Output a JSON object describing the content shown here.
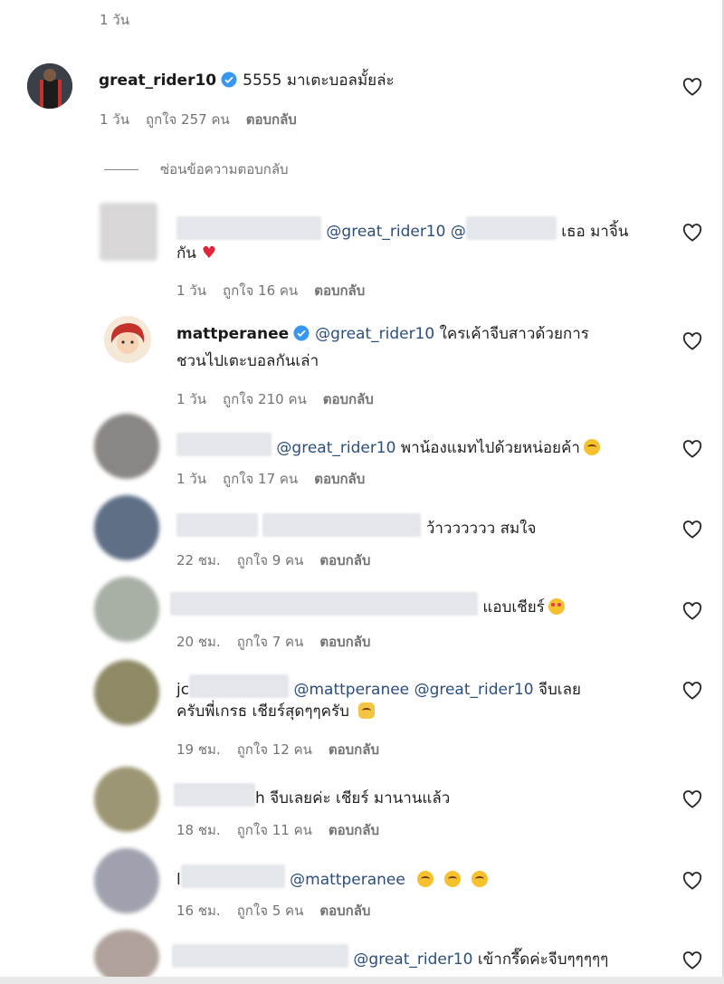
{
  "top_meta": "1 วัน",
  "parent_comment": {
    "username": "great_rider10",
    "text": "5555 มาเตะบอลมั้ยล่ะ",
    "time": "1 วัน",
    "likes": "ถูกใจ 257 คน",
    "reply": "ตอบกลับ"
  },
  "hide_replies": "ซ่อนข้อความตอบกลับ",
  "replies": [
    {
      "line1_mentions": [
        "@great_rider10",
        "@"
      ],
      "line1_tail": "เธอ มาจิ้น",
      "line2": "กัน",
      "time": "1 วัน",
      "likes": "ถูกใจ 16 คน",
      "reply": "ตอบกลับ"
    },
    {
      "username": "mattperanee",
      "mention": "@great_rider10",
      "line1_tail": "ใครเค้าจีบสาวด้วยการ",
      "line2": "ชวนไปเตะบอลกันเล่า",
      "time": "1 วัน",
      "likes": "ถูกใจ 210 คน",
      "reply": "ตอบกลับ"
    },
    {
      "mention": "@great_rider10",
      "line1_tail": "พาน้องแมทไปด้วยหน่อยค้า",
      "time": "1 วัน",
      "likes": "ถูกใจ 17 คน",
      "reply": "ตอบกลับ"
    },
    {
      "line1_tail": "ว้าวววววว สมใจ",
      "time": "22 ชม.",
      "likes": "ถูกใจ 9 คน",
      "reply": "ตอบกลับ"
    },
    {
      "line1_tail": "แอบเชียร์",
      "time": "20 ชม.",
      "likes": "ถูกใจ 7 คน",
      "reply": "ตอบกลับ"
    },
    {
      "prefix": "jc",
      "mention1": "@mattperanee",
      "mention2": "@great_rider10",
      "line1_tail": "จีบเลย",
      "line2": "ครับพี่เกรธ เชียร์สุดๆๆครับ",
      "time": "19 ชม.",
      "likes": "ถูกใจ 12 คน",
      "reply": "ตอบกลับ"
    },
    {
      "prefix": "h",
      "line1_tail": "จีบเลยค่ะ เชียร์ มานานแล้ว",
      "time": "18 ชม.",
      "likes": "ถูกใจ 11 คน",
      "reply": "ตอบกลับ"
    },
    {
      "prefix": "l",
      "mention": "@mattperanee",
      "time": "16 ชม.",
      "likes": "ถูกใจ 5 คน",
      "reply": "ตอบกลับ"
    },
    {
      "mention": "@great_rider10",
      "line1_tail": "เข้ากรี๊ดค่ะจีบๆๆๆๆๆ"
    }
  ],
  "colors": {
    "mention": "#2b4e7e",
    "verified": "#3897f0",
    "meta": "#737373"
  }
}
